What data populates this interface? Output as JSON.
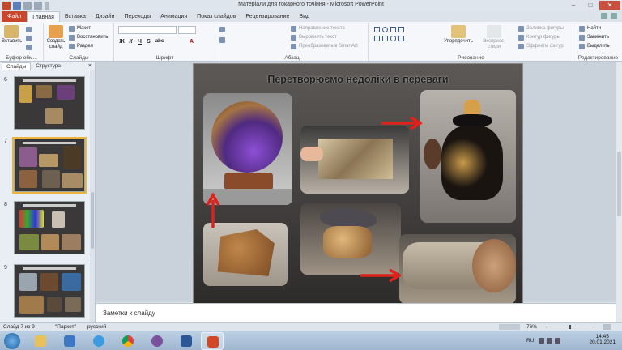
{
  "window": {
    "title": "Матеріали для токарного точіння - Microsoft PowerPoint",
    "controls": {
      "minimize": "–",
      "maximize": "□",
      "close": "✕"
    }
  },
  "tabs": [
    "Файл",
    "Главная",
    "Вставка",
    "Дизайн",
    "Переходы",
    "Анимация",
    "Показ слайдов",
    "Рецензирование",
    "Вид"
  ],
  "ribbon": {
    "clipboard": {
      "paste": "Вставить",
      "label": "Буфер обм..."
    },
    "slides": {
      "create": "Создать слайд",
      "layout": "Макет",
      "reset": "Восстановить",
      "section": "Раздел",
      "label": "Слайды"
    },
    "font": {
      "bold": "Ж",
      "italic": "К",
      "underline": "Ч",
      "shadow": "S",
      "strike": "abc",
      "color": "A",
      "label": "Шрифт"
    },
    "paragraph": {
      "direction": "Направление текста",
      "align": "Выровнять текст",
      "smartart": "Преобразовать в SmartArt",
      "label": "Абзац"
    },
    "drawing": {
      "arrange": "Упорядочить",
      "styles": "Экспресс-стили",
      "fill": "Заливка фигуры",
      "outline": "Контур фигуры",
      "effects": "Эффекты фигур",
      "label": "Рисование"
    },
    "editing": {
      "find": "Найти",
      "replace": "Заменить",
      "select": "Выделить",
      "label": "Редактирование"
    }
  },
  "pane": {
    "tabs": [
      "Слайды",
      "Структура"
    ],
    "close": "×",
    "slides": [
      {
        "num": "6"
      },
      {
        "num": "7"
      },
      {
        "num": "8"
      },
      {
        "num": "9"
      }
    ]
  },
  "slide": {
    "title": "Перетворюємо недоліки в переваги"
  },
  "notes": {
    "placeholder": "Заметки к слайду"
  },
  "status": {
    "slide": "Слайд 7 из 9",
    "theme": "\"Паркет\"",
    "lang": "русский",
    "zoom": "76%"
  },
  "taskbar": {
    "lang": "RU",
    "time": "14:45",
    "date": "20.01.2021"
  },
  "colors": {
    "file_tab": "#c8462a",
    "arrow": "#e0201a",
    "selection": "#f0b43b"
  }
}
